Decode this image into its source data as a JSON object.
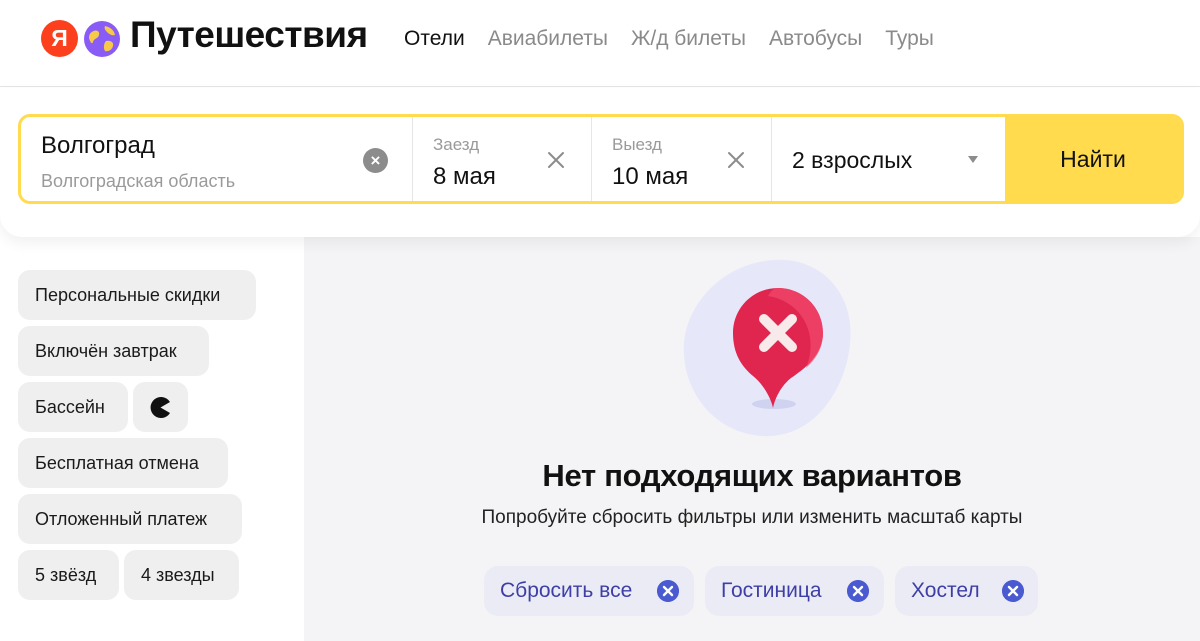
{
  "header": {
    "logo_letter": "Я",
    "title": "Путешествия",
    "nav": [
      "Отели",
      "Авиабилеты",
      "Ж/д билеты",
      "Автобусы",
      "Туры"
    ],
    "active_nav": "Отели"
  },
  "search": {
    "city": "Волгоград",
    "region": "Волгоградская область",
    "checkin_label": "Заезд",
    "checkin_value": "8 мая",
    "checkout_label": "Выезд",
    "checkout_value": "10 мая",
    "guests": "2 взрослых",
    "submit": "Найти",
    "accent_color": "#ffdb4d"
  },
  "filters": [
    "Персональные скидки",
    "Включён завтрак",
    "Бассейн",
    "Бесплатная отмена",
    "Отложенный платеж",
    "5 звёзд",
    "4 звезды"
  ],
  "filter_icon": "pacman-icon",
  "empty_state": {
    "title": "Нет подходящих вариантов",
    "subtitle": "Попробуйте сбросить фильтры или изменить масштаб карты",
    "chips": [
      "Сбросить все",
      "Гостиница",
      "Хостел"
    ]
  }
}
